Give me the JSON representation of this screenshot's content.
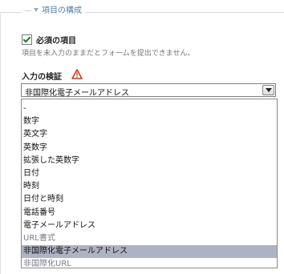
{
  "section": {
    "legend": "項目の構成"
  },
  "required": {
    "label": "必須の項目",
    "checked": true,
    "help": "項目を未入力のままだとフォームを提出できません。"
  },
  "validation": {
    "label": "入力の検証",
    "selected_value": "非国際化電子メールアドレス",
    "options": [
      "-",
      "数字",
      "英文字",
      "英数字",
      "拡張した英数字",
      "日付",
      "時刻",
      "日付と時刻",
      "電話番号",
      "電子メールアドレス",
      "URL書式",
      "非国際化電子メールアドレス",
      "非国際化URL"
    ],
    "highlighted_index": 11
  },
  "icons": {
    "legend": "expand-triangle-icon",
    "warning": "warning-icon",
    "select_arrow": "chevron-down-icon"
  }
}
